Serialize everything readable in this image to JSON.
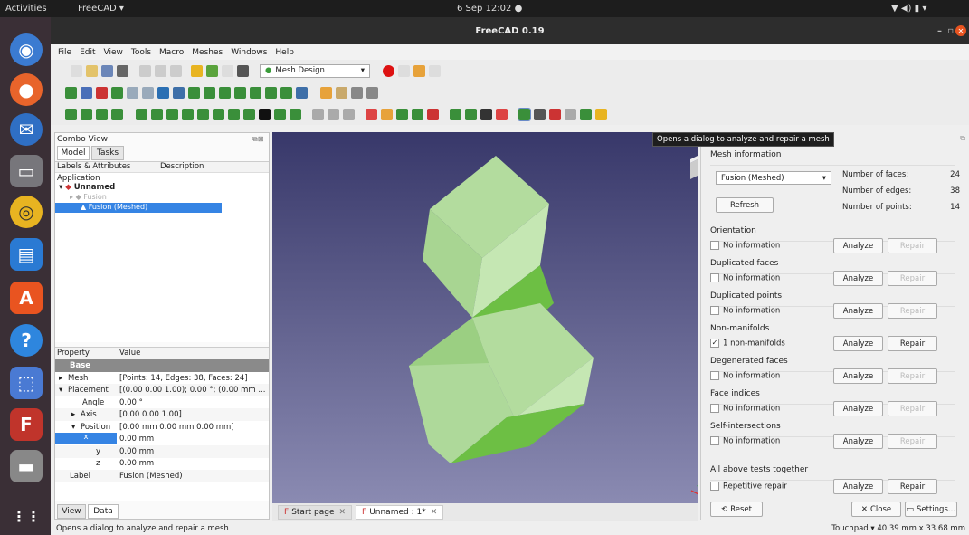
{
  "topbar": {
    "activities": "Activities",
    "app": "FreeCAD ▾",
    "clock": "6 Sep 12:02 ●"
  },
  "window": {
    "title": "FreeCAD 0.19"
  },
  "menu": [
    "File",
    "Edit",
    "View",
    "Tools",
    "Macro",
    "Meshes",
    "Windows",
    "Help"
  ],
  "workbench": "Mesh Design",
  "tooltip": "Opens a dialog to analyze and repair a mesh",
  "combo": {
    "title": "Combo View",
    "tabs": [
      "Model",
      "Tasks"
    ],
    "tree_headers": [
      "Labels & Attributes",
      "Description"
    ],
    "tree": {
      "application": "Application",
      "doc": "Unnamed",
      "fusion": "Fusion",
      "fusion_meshed": "Fusion (Meshed)"
    },
    "prop_headers": [
      "Property",
      "Value"
    ],
    "props": [
      {
        "name": "Base",
        "value": ""
      },
      {
        "name": "Mesh",
        "value": "[Points: 14, Edges: 38, Faces: 24]"
      },
      {
        "name": "Placement",
        "value": "[(0.00 0.00 1.00); 0.00 °; (0.00 mm ..."
      },
      {
        "name": "Angle",
        "value": "0.00 °"
      },
      {
        "name": "Axis",
        "value": "[0.00 0.00 1.00]"
      },
      {
        "name": "Position",
        "value": "[0.00 mm  0.00 mm  0.00 mm]"
      },
      {
        "name": "x",
        "value": "0.00 mm"
      },
      {
        "name": "y",
        "value": "0.00 mm"
      },
      {
        "name": "z",
        "value": "0.00 mm"
      },
      {
        "name": "Label",
        "value": "Fusion (Meshed)"
      }
    ],
    "bottom_tabs": [
      "View",
      "Data"
    ]
  },
  "doc_tabs": [
    "Start page",
    "Unnamed : 1*"
  ],
  "panel": {
    "mesh_info": "Mesh information",
    "mesh_select": "Fusion (Meshed)",
    "refresh": "Refresh",
    "faces_label": "Number of faces:",
    "faces": "24",
    "edges_label": "Number of edges:",
    "edges": "38",
    "points_label": "Number of points:",
    "points": "14",
    "sections": [
      {
        "title": "Orientation",
        "status": "No information",
        "checked": false,
        "repair_enabled": false
      },
      {
        "title": "Duplicated faces",
        "status": "No information",
        "checked": false,
        "repair_enabled": false
      },
      {
        "title": "Duplicated points",
        "status": "No information",
        "checked": false,
        "repair_enabled": false
      },
      {
        "title": "Non-manifolds",
        "status": "1 non-manifolds",
        "checked": true,
        "repair_enabled": true
      },
      {
        "title": "Degenerated faces",
        "status": "No information",
        "checked": false,
        "repair_enabled": false
      },
      {
        "title": "Face indices",
        "status": "No information",
        "checked": false,
        "repair_enabled": false
      },
      {
        "title": "Self-intersections",
        "status": "No information",
        "checked": false,
        "repair_enabled": false
      }
    ],
    "analyze": "Analyze",
    "repair": "Repair",
    "all_tests": "All above tests together",
    "repetitive": "Repetitive repair",
    "reset": "Reset",
    "close": "Close",
    "settings": "Settings..."
  },
  "status": {
    "left": "Opens a dialog to analyze and repair a mesh",
    "right": "Touchpad ▾  40.39 mm x 33.68 mm"
  }
}
